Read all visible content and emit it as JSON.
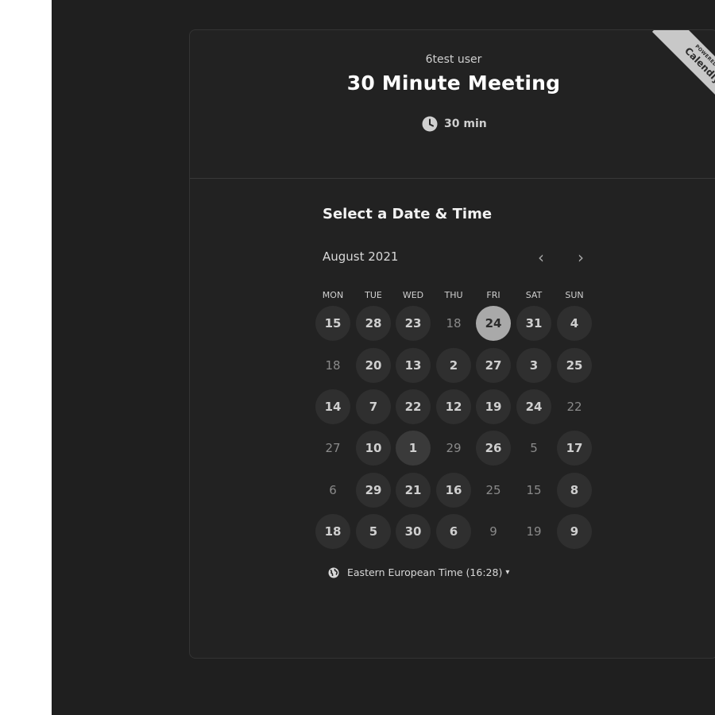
{
  "header": {
    "org_name": "6test user",
    "event_title": "30 Minute Meeting",
    "duration": "30 min",
    "ribbon_small": "POWERED BY",
    "ribbon_brand": "Calendly"
  },
  "calendar": {
    "section_title": "Select a Date & Time",
    "month_label": "August 2021",
    "prev_icon": "‹",
    "next_icon": "›",
    "weekdays": [
      "MON",
      "TUE",
      "WED",
      "THU",
      "FRI",
      "SAT",
      "SUN"
    ],
    "rows": [
      [
        {
          "d": "15",
          "s": "a"
        },
        {
          "d": "28",
          "s": "a"
        },
        {
          "d": "23",
          "s": "a"
        },
        {
          "d": "18",
          "s": "u"
        },
        {
          "d": "24",
          "s": "sel"
        },
        {
          "d": "31",
          "s": "a"
        },
        {
          "d": "4",
          "s": "a"
        }
      ],
      [
        {
          "d": "18",
          "s": "u"
        },
        {
          "d": "20",
          "s": "a"
        },
        {
          "d": "13",
          "s": "a"
        },
        {
          "d": "2",
          "s": "a"
        },
        {
          "d": "27",
          "s": "a"
        },
        {
          "d": "3",
          "s": "a"
        },
        {
          "d": "25",
          "s": "a"
        }
      ],
      [
        {
          "d": "14",
          "s": "a"
        },
        {
          "d": "7",
          "s": "a"
        },
        {
          "d": "22",
          "s": "a"
        },
        {
          "d": "12",
          "s": "a"
        },
        {
          "d": "19",
          "s": "a"
        },
        {
          "d": "24",
          "s": "a"
        },
        {
          "d": "22",
          "s": "u"
        }
      ],
      [
        {
          "d": "27",
          "s": "u"
        },
        {
          "d": "10",
          "s": "a"
        },
        {
          "d": "1",
          "s": "l"
        },
        {
          "d": "29",
          "s": "u"
        },
        {
          "d": "26",
          "s": "a"
        },
        {
          "d": "5",
          "s": "u"
        },
        {
          "d": "17",
          "s": "a"
        }
      ],
      [
        {
          "d": "6",
          "s": "u"
        },
        {
          "d": "29",
          "s": "a"
        },
        {
          "d": "21",
          "s": "a"
        },
        {
          "d": "16",
          "s": "a"
        },
        {
          "d": "25",
          "s": "u"
        },
        {
          "d": "15",
          "s": "u"
        },
        {
          "d": "8",
          "s": "a"
        }
      ],
      [
        {
          "d": "18",
          "s": "a"
        },
        {
          "d": "5",
          "s": "a"
        },
        {
          "d": "30",
          "s": "a"
        },
        {
          "d": "6",
          "s": "a"
        },
        {
          "d": "9",
          "s": "u"
        },
        {
          "d": "19",
          "s": "u"
        },
        {
          "d": "9",
          "s": "a"
        }
      ]
    ]
  },
  "timezone": {
    "label": "Eastern European Time (16:28)",
    "icon": "globe-icon",
    "caret": "▾"
  },
  "colors": {
    "page_bg": "#1f1f1f",
    "card_bg": "#222222",
    "available_day": "#2f2f2f",
    "selected_day": "#a9a9a9"
  }
}
